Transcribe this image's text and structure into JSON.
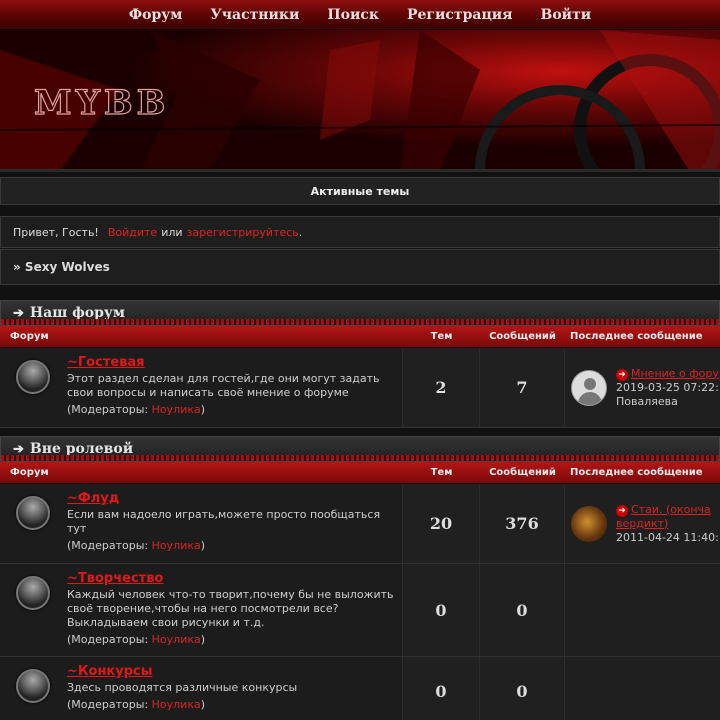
{
  "nav": [
    "Форум",
    "Участники",
    "Поиск",
    "Регистрация",
    "Войти"
  ],
  "banner": {
    "logo_text": "MYBB"
  },
  "active_topics": "Активные темы",
  "greeting": {
    "prefix": "Привет, Гость!",
    "login": "Войдите",
    "or": "или",
    "register": "зарегистрируйтесь",
    "suffix": "."
  },
  "breadcrumb": "» Sexy Wolves",
  "columns": {
    "forum": "Форум",
    "topics": "Тем",
    "posts": "Сообщений",
    "last": "Последнее сообщение"
  },
  "moderators_label": "(Модераторы:",
  "categories": [
    {
      "title": "Наш форум",
      "forums": [
        {
          "name": "~Гостевая",
          "desc": "Этот раздел сделан для гостей,где они могут задать свои вопросы и написать своё мнение о форуме",
          "moderator": "Ноулика",
          "topics": "2",
          "posts": "7",
          "last_title": "Мнение о фору",
          "last_date": "2019-03-25 07:22:",
          "last_by": "Поваляева",
          "avatar": "guest"
        }
      ]
    },
    {
      "title": "Вне ролевой",
      "forums": [
        {
          "name": "~Флуд",
          "desc": "Если вам надоело играть,можете просто пообщаться тут",
          "moderator": "Ноулика",
          "topics": "20",
          "posts": "376",
          "last_title": "Стаи. (оконча",
          "last_title2": "вердикт)",
          "last_date": "2011-04-24 11:40:",
          "avatar": "photo"
        },
        {
          "name": "~Творчество",
          "desc": "Каждый человек что-то творит,почему бы не выложить своё творение,чтобы на него посмотрели все? Выкладываем свои рисунки и т.д.",
          "moderator": "Ноулика",
          "topics": "0",
          "posts": "0"
        },
        {
          "name": "~Конкурсы",
          "desc": "Здесь проводятся различные конкурсы",
          "moderator": "Ноулика",
          "topics": "0",
          "posts": "0"
        }
      ]
    }
  ]
}
